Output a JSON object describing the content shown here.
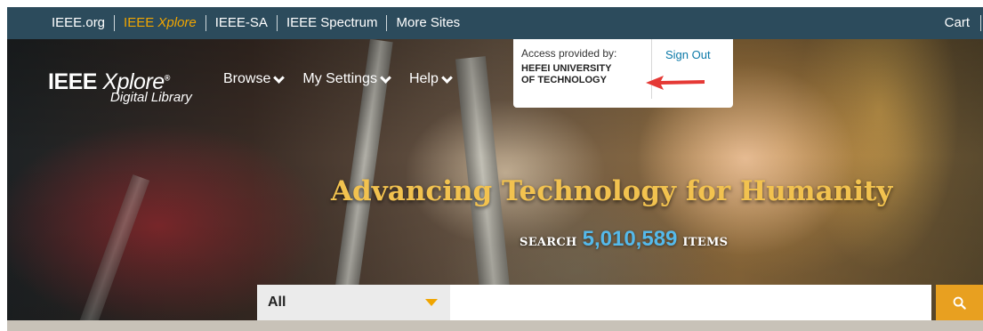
{
  "meta_bar": {
    "links": [
      {
        "label": "IEEE.org"
      },
      {
        "label_a": "IEEE ",
        "label_b": "Xplore"
      },
      {
        "label": "IEEE-SA"
      },
      {
        "label": "IEEE Spectrum"
      },
      {
        "label": "More Sites"
      }
    ],
    "cart": "Cart"
  },
  "logo": {
    "main_a": "IEEE ",
    "main_b": "Xplore",
    "reg": "®",
    "sub": "Digital Library"
  },
  "nav": [
    {
      "label": "Browse"
    },
    {
      "label": "My Settings"
    },
    {
      "label": "Help"
    }
  ],
  "access": {
    "label": "Access provided by:",
    "institution_line1": "HEFEI UNIVERSITY",
    "institution_line2": "OF TECHNOLOGY",
    "sign_out": "Sign Out"
  },
  "hero": {
    "headline": "Advancing Technology for Humanity",
    "search_prefix": "SEARCH",
    "count": "5,010,589",
    "search_suffix": "ITEMS"
  },
  "search": {
    "select_value": "All",
    "input_value": "",
    "placeholder": ""
  },
  "colors": {
    "bar": "#2c4b5c",
    "accent": "#f0a500",
    "link": "#0b79a8",
    "count": "#55b9ea",
    "arrow": "#e53935"
  },
  "icons": {
    "search_button": "search-icon",
    "dropdown": "caret-down-icon",
    "arrow": "red-arrow-annotation"
  }
}
